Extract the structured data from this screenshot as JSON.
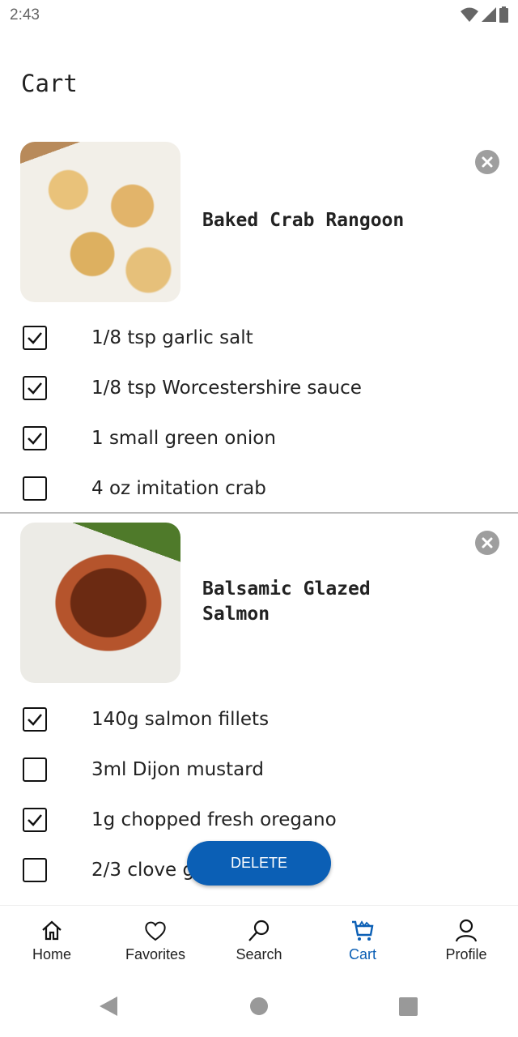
{
  "status": {
    "time": "2:43"
  },
  "page": {
    "title": "Cart"
  },
  "colors": {
    "accent": "#0b5fb5",
    "close": "#9e9e9e"
  },
  "cards": [
    {
      "title": "Baked Crab Rangoon",
      "items": [
        {
          "label": "1/8 tsp garlic salt",
          "checked": true
        },
        {
          "label": "1/8 tsp Worcestershire sauce",
          "checked": true
        },
        {
          "label": "1 small green onion",
          "checked": true
        },
        {
          "label": "4 oz imitation crab",
          "checked": false
        }
      ]
    },
    {
      "title_line1": "Balsamic Glazed",
      "title_line2": "Salmon",
      "items": [
        {
          "label": "140g salmon fillets",
          "checked": true
        },
        {
          "label": "3ml Dijon mustard",
          "checked": false
        },
        {
          "label": "1g chopped fresh oregano",
          "checked": true
        },
        {
          "label": "2/3 clove garlic",
          "checked": false
        }
      ]
    }
  ],
  "delete_label": "DELETE",
  "nav": [
    {
      "label": "Home",
      "icon": "home-icon"
    },
    {
      "label": "Favorites",
      "icon": "heart-icon"
    },
    {
      "label": "Search",
      "icon": "search-icon"
    },
    {
      "label": "Cart",
      "icon": "cart-icon",
      "active": true
    },
    {
      "label": "Profile",
      "icon": "person-icon"
    }
  ]
}
